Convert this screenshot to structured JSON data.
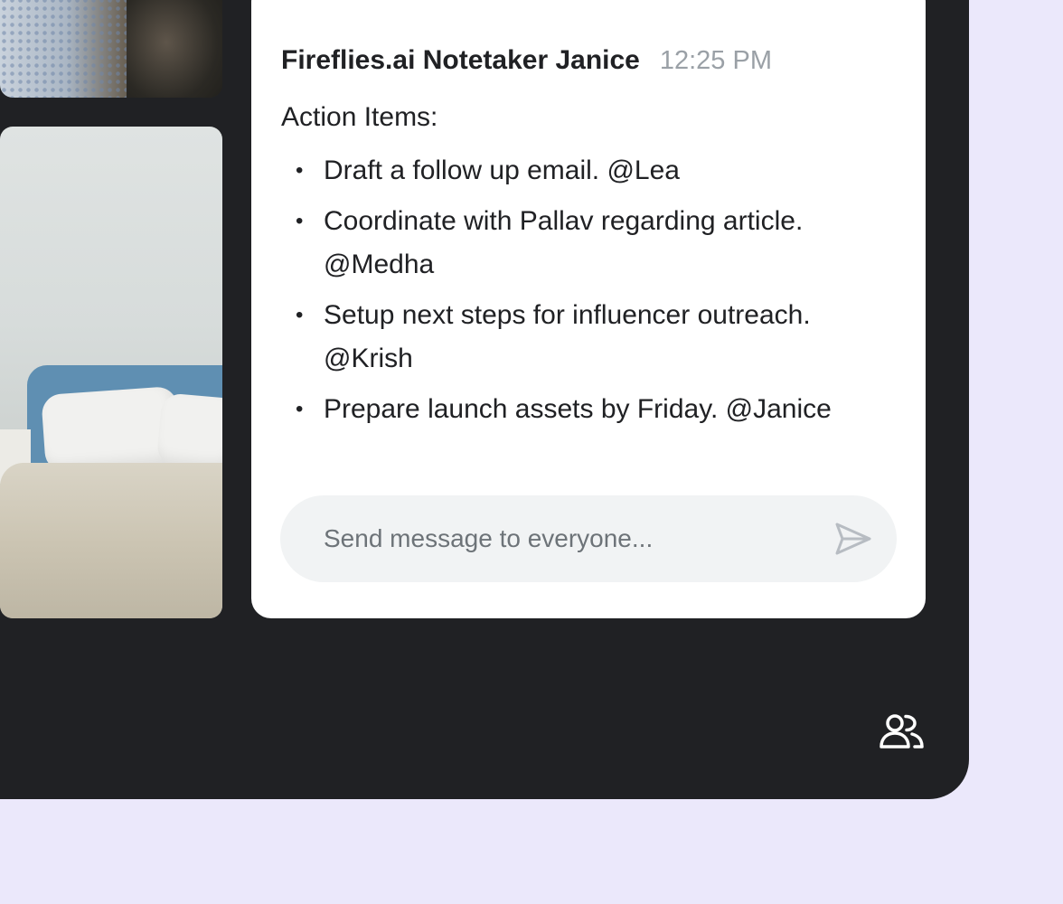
{
  "chat": {
    "sender": "Fireflies.ai Notetaker Janice",
    "timestamp": "12:25 PM",
    "title": "Action Items:",
    "bullet": "•",
    "items": [
      {
        "line1": "Draft a follow up email. @Lea",
        "line2": ""
      },
      {
        "line1": "Coordinate with Pallav regarding article.",
        "line2": "@Medha"
      },
      {
        "line1": "Setup next steps for influencer outreach.",
        "line2": "@Krish"
      },
      {
        "line1": "Prepare launch assets by Friday. @Janice",
        "line2": ""
      }
    ]
  },
  "composer": {
    "placeholder": "Send message to everyone...",
    "value": "",
    "send_icon": "send-icon"
  },
  "toolbar": {
    "people_icon": "people-icon"
  },
  "colors": {
    "page_background": "#ebe8fb",
    "meet_background": "#202124",
    "panel_background": "#ffffff",
    "text": "#202124",
    "muted_text": "#9aa0a6",
    "composer_background": "#f1f3f4"
  }
}
